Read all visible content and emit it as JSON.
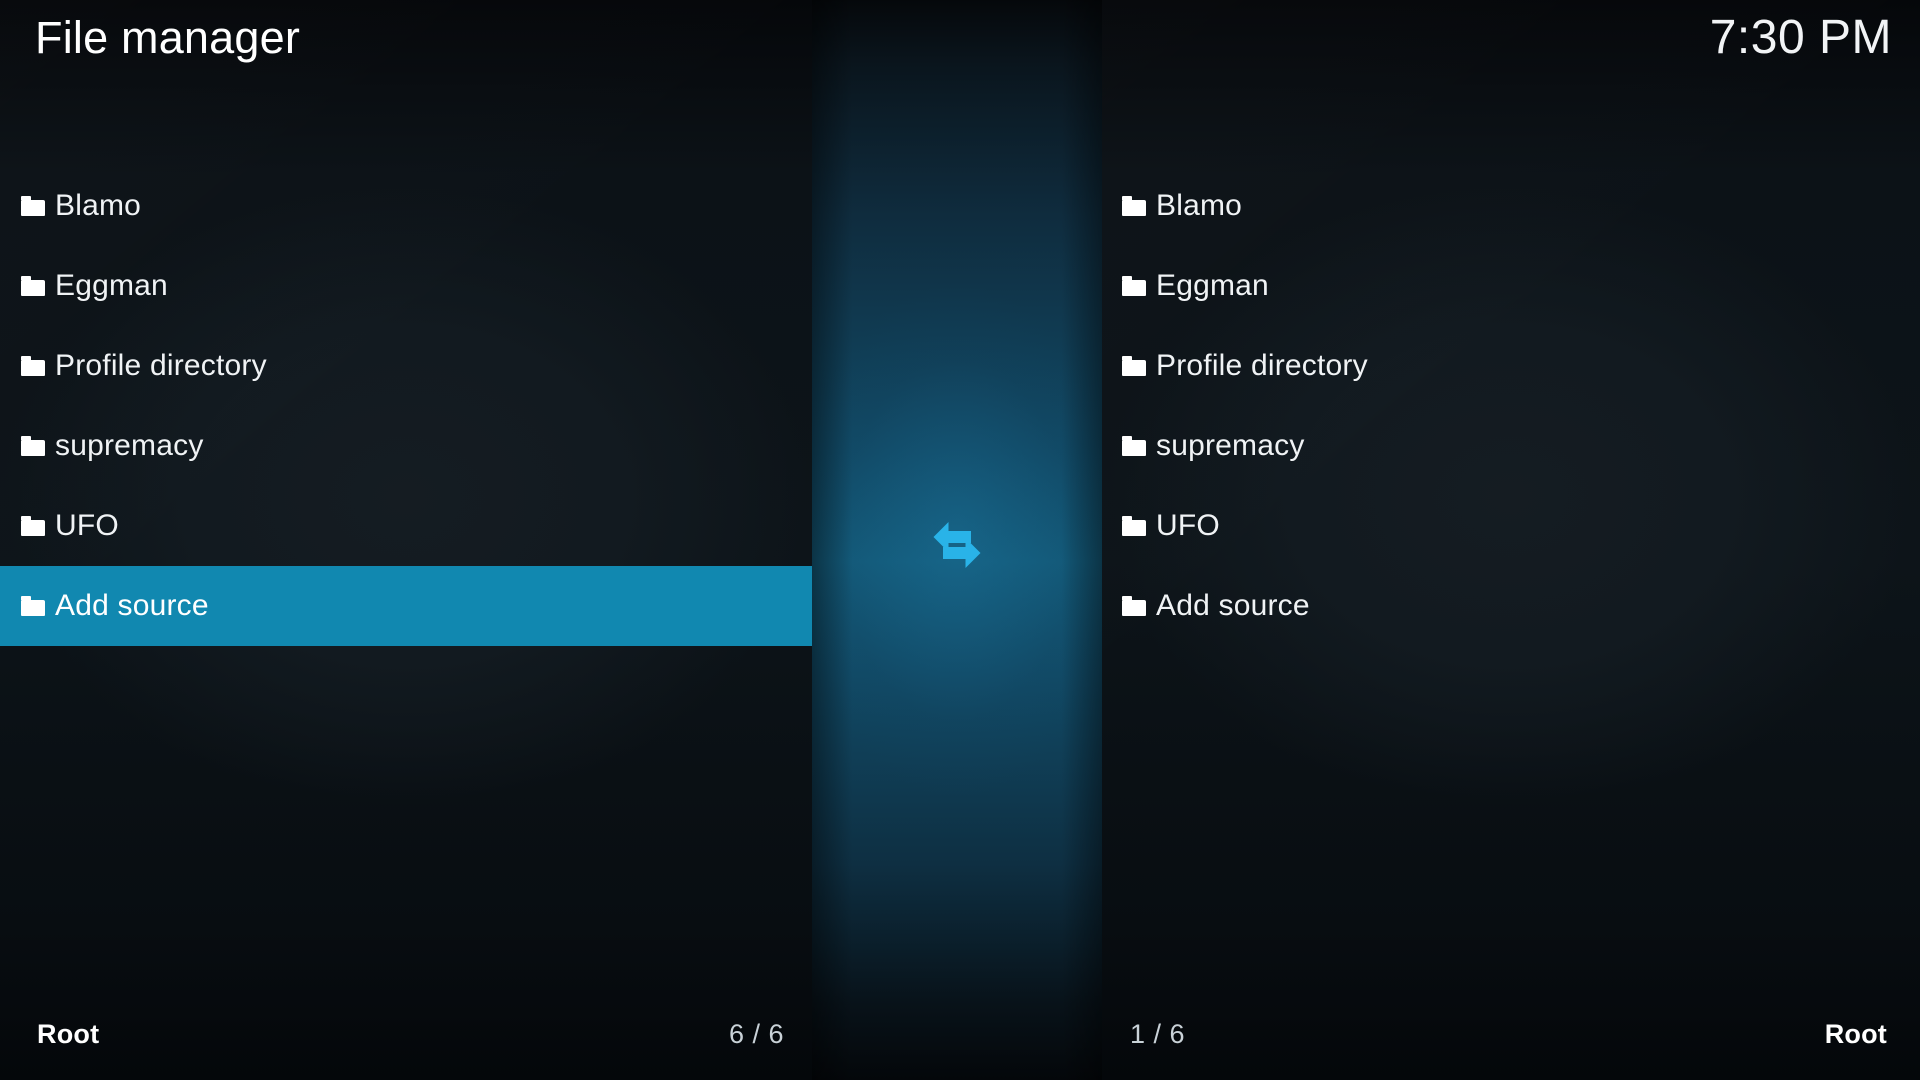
{
  "header": {
    "title": "File manager",
    "clock": "7:30 PM"
  },
  "splitter": {
    "icon": "swap-horizontal-arrows-icon",
    "icon_color": "#29b3e8"
  },
  "theme": {
    "background": "#0c1115",
    "selection": "#1188b0",
    "text": "#f0f3f5",
    "accent": "#29b3e8"
  },
  "left_panel": {
    "items": [
      {
        "label": "Blamo",
        "icon": "folder-icon",
        "selected": false
      },
      {
        "label": "Eggman",
        "icon": "folder-icon",
        "selected": false
      },
      {
        "label": "Profile directory",
        "icon": "folder-icon",
        "selected": false
      },
      {
        "label": "supremacy",
        "icon": "folder-icon",
        "selected": false
      },
      {
        "label": "UFO",
        "icon": "folder-icon",
        "selected": false
      },
      {
        "label": "Add source",
        "icon": "folder-icon",
        "selected": true
      }
    ],
    "footer": {
      "path": "Root",
      "count": "6 / 6"
    }
  },
  "right_panel": {
    "items": [
      {
        "label": "Blamo",
        "icon": "folder-icon",
        "selected": false
      },
      {
        "label": "Eggman",
        "icon": "folder-icon",
        "selected": false
      },
      {
        "label": "Profile directory",
        "icon": "folder-icon",
        "selected": false
      },
      {
        "label": "supremacy",
        "icon": "folder-icon",
        "selected": false
      },
      {
        "label": "UFO",
        "icon": "folder-icon",
        "selected": false
      },
      {
        "label": "Add source",
        "icon": "folder-icon",
        "selected": false
      }
    ],
    "footer": {
      "path": "Root",
      "count": "1 / 6"
    }
  }
}
